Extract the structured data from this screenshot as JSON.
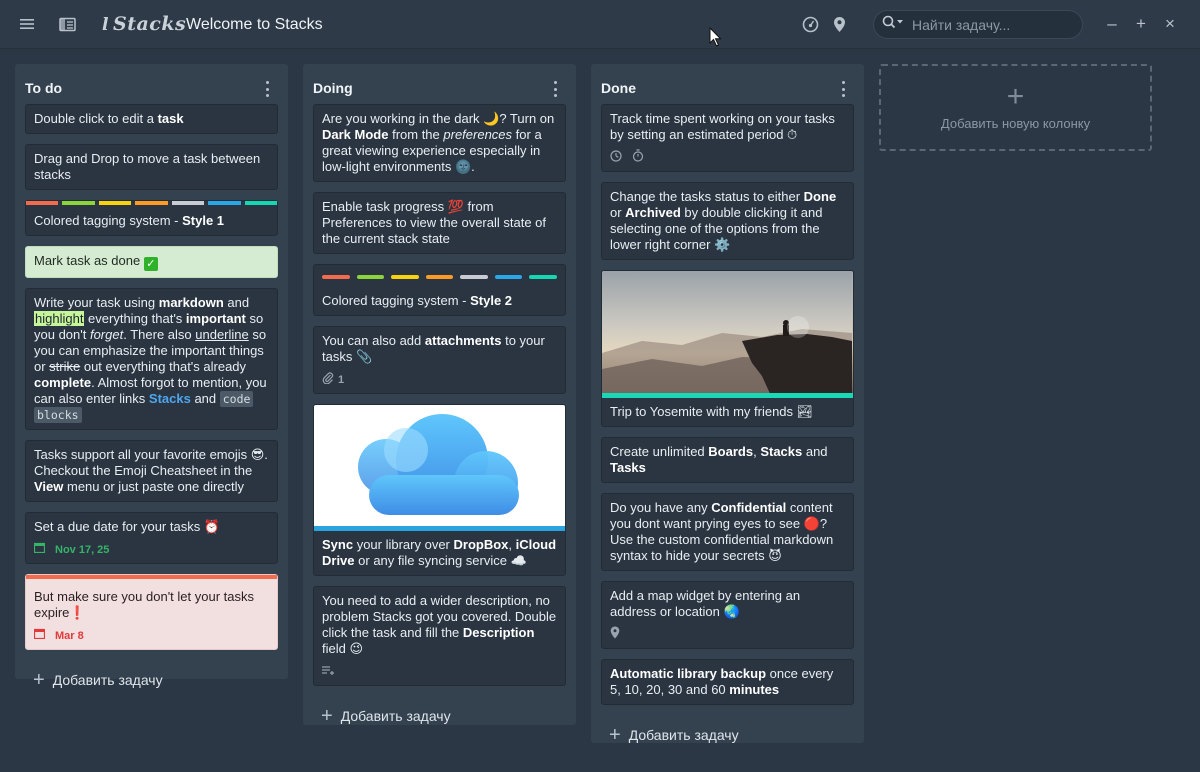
{
  "app": {
    "logo": "Stacks",
    "title": "Welcome to Stacks",
    "search_placeholder": "Найти задачу...",
    "window_controls": [
      "minimize",
      "maximize",
      "close"
    ]
  },
  "columns": [
    {
      "title": "To do",
      "add_task_label": "Добавить задачу",
      "cards": [
        {
          "text": "Double click to edit a task"
        },
        {
          "text": "Drag and Drop to move a task between stacks"
        },
        {
          "text": "Colored tagging system - Style 1",
          "tags": [
            "#f26b4c",
            "#8bd43a",
            "#f8d20e",
            "#fb9b26",
            "#c6ccd1",
            "#29a7e9",
            "#15d7b1"
          ]
        },
        {
          "text": "Mark task as done",
          "state": "done"
        },
        {
          "text": "Write your task using markdown and highlight everything that's important so you don't forget. There also underline so you can emphasize the important things or strike out everything that's already complete. Almost forgot to mention, you can also enter links Stacks and code blocks",
          "link": "Stacks",
          "code": [
            "code",
            "blocks"
          ]
        },
        {
          "text": "Tasks support all your favorite emojis 😎. Checkout the Emoji Cheatsheet in the View menu or just paste one directly"
        },
        {
          "text": "Set a due date for your tasks ⏰",
          "due": "Nov 17, 25"
        },
        {
          "text": "But make sure you don't let your tasks expire❗",
          "due": "Mar 8",
          "state": "expired"
        }
      ]
    },
    {
      "title": "Doing",
      "add_task_label": "Добавить задачу",
      "cards": [
        {
          "text": "Are you working in the dark 🌙? Turn on Dark Mode from the preferences for a great viewing experience especially in low-light environments 🌚."
        },
        {
          "text": "Enable task progress 💯 from Preferences to view the overall state of the current stack state"
        },
        {
          "text": "Colored tagging system - Style 2",
          "tags": [
            "#f26b4c",
            "#8bd43a",
            "#f8d20e",
            "#fb9b26",
            "#c6ccd1",
            "#29a7e9",
            "#15d7b1"
          ]
        },
        {
          "text": "You can also add attachments to your tasks 📎",
          "attachments": "1"
        },
        {
          "text": "Sync your library over DropBox, iCloud Drive or any file syncing service ☁️",
          "image": "cloud"
        },
        {
          "text": "You need to add a wider description, no problem Stacks got you covered. Double click the task and fill the Description field 😉"
        }
      ]
    },
    {
      "title": "Done",
      "add_task_label": "Добавить задачу",
      "cards": [
        {
          "text": "Track time spent working on your tasks by setting an estimated period ⏱"
        },
        {
          "text": "Change the tasks status to either Done or Archived by double clicking it and selecting one of the options from the lower right corner ⚙️"
        },
        {
          "text": "Trip to Yosemite with my friends 🏞",
          "image": "photo"
        },
        {
          "text": "Create unlimited Boards, Stacks and Tasks"
        },
        {
          "text": "Do you have any Confidential content you dont want prying eyes to see 🔴? Use the custom confidential markdown syntax to hide your secrets 😈"
        },
        {
          "text": "Add a map widget by entering an address or location 🌏"
        },
        {
          "text": "Automatic library backup once every 5, 10, 20, 30 and 60 minutes"
        }
      ]
    }
  ],
  "add_column_label": "Добавить новую колонку",
  "colors": {
    "background": "#2b3744",
    "column": "#344250",
    "card": "#2a3541",
    "link": "#4ea6ee",
    "done_card": "#d6ecd2",
    "expired_card": "#f2dfe0"
  }
}
